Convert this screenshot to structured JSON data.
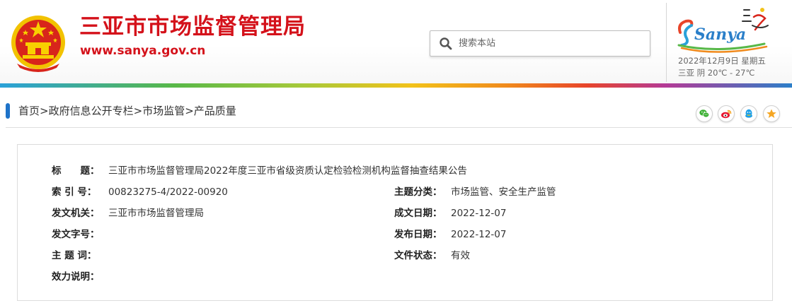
{
  "header": {
    "title": "三亚市市场监督管理局",
    "url": "www.sanya.gov.cn",
    "search_placeholder": "搜索本站",
    "logo_text": "Sanya",
    "date": "2022年12月9日 星期五",
    "weather": "三亚 阴 20℃ - 27℃"
  },
  "breadcrumb": {
    "items": [
      "首页",
      "政府信息公开专栏",
      "市场监管",
      "产品质量"
    ],
    "separator": ">"
  },
  "share": [
    "wechat-icon",
    "weibo-icon",
    "qq-icon",
    "favorite-icon"
  ],
  "info": {
    "title_label": "标　　题：",
    "title_value": "三亚市市场监督管理局2022年度三亚市省级资质认定检验检测机构监督抽查结果公告",
    "index_label": "索 引 号：",
    "index_value": "00823275-4/2022-00920",
    "topic_label": "主题分类：",
    "topic_value": "市场监管、安全生产监管",
    "issuer_label": "发文机关：",
    "issuer_value": "三亚市市场监督管理局",
    "created_label": "成文日期：",
    "created_value": "2022-12-07",
    "docno_label": "发文字号：",
    "docno_value": "",
    "published_label": "发布日期：",
    "published_value": "2022-12-07",
    "keywords_label": "主 题 词：",
    "keywords_value": "",
    "status_label": "文件状态：",
    "status_value": "有效",
    "validity_label": "效力说明：",
    "validity_value": ""
  },
  "colors": {
    "brand_red": "#d4111a",
    "accent_blue": "#1e73c9"
  }
}
